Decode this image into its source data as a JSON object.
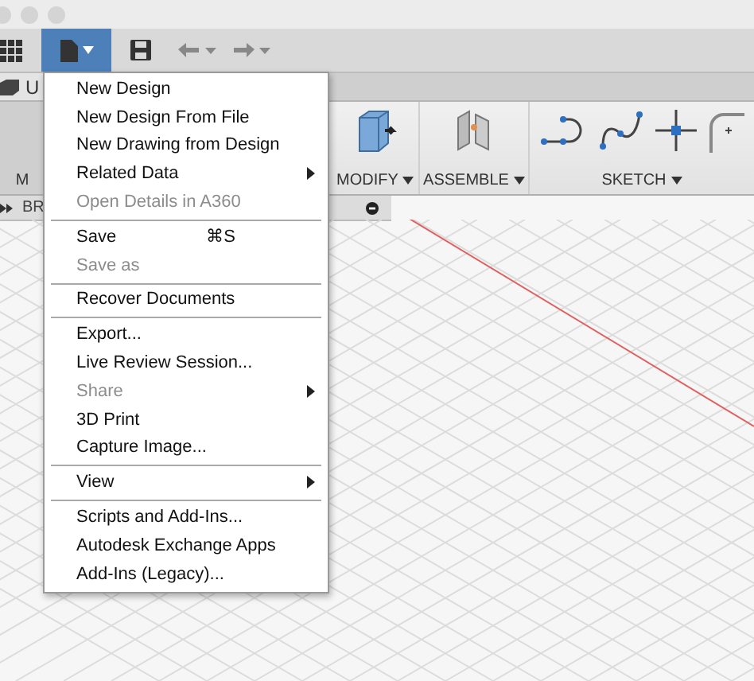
{
  "toolbar": {
    "file_button_active": true
  },
  "document_tab": {
    "label": "U"
  },
  "ribbon": {
    "groups": [
      {
        "label": "M",
        "kind": "solid"
      },
      {
        "label": "MODIFY",
        "kind": "modify"
      },
      {
        "label": "ASSEMBLE",
        "kind": "assemble"
      },
      {
        "label": "SKETCH",
        "kind": "sketch"
      }
    ]
  },
  "browser": {
    "label": "BR"
  },
  "file_menu": {
    "groups": [
      [
        {
          "label": "New Design",
          "disabled": false,
          "submenu": false
        },
        {
          "label": "New Design From File",
          "disabled": false,
          "submenu": false
        },
        {
          "label": "New Drawing from Design",
          "disabled": false,
          "submenu": false
        },
        {
          "label": "Related Data",
          "disabled": false,
          "submenu": true
        },
        {
          "label": "Open Details in A360",
          "disabled": true,
          "submenu": false
        }
      ],
      [
        {
          "label": "Save",
          "disabled": false,
          "submenu": false,
          "shortcut": "⌘S"
        },
        {
          "label": "Save as",
          "disabled": true,
          "submenu": false
        }
      ],
      [
        {
          "label": "Recover Documents",
          "disabled": false,
          "submenu": false
        }
      ],
      [
        {
          "label": "Export...",
          "disabled": false,
          "submenu": false
        },
        {
          "label": "Live Review Session...",
          "disabled": false,
          "submenu": false
        },
        {
          "label": "Share",
          "disabled": true,
          "submenu": true
        },
        {
          "label": "3D Print",
          "disabled": false,
          "submenu": false
        },
        {
          "label": "Capture Image...",
          "disabled": false,
          "submenu": false
        }
      ],
      [
        {
          "label": "View",
          "disabled": false,
          "submenu": true
        }
      ],
      [
        {
          "label": "Scripts and Add-Ins...",
          "disabled": false,
          "submenu": false
        },
        {
          "label": "Autodesk Exchange Apps",
          "disabled": false,
          "submenu": false
        },
        {
          "label": "Add-Ins (Legacy)...",
          "disabled": false,
          "submenu": false
        }
      ]
    ]
  }
}
